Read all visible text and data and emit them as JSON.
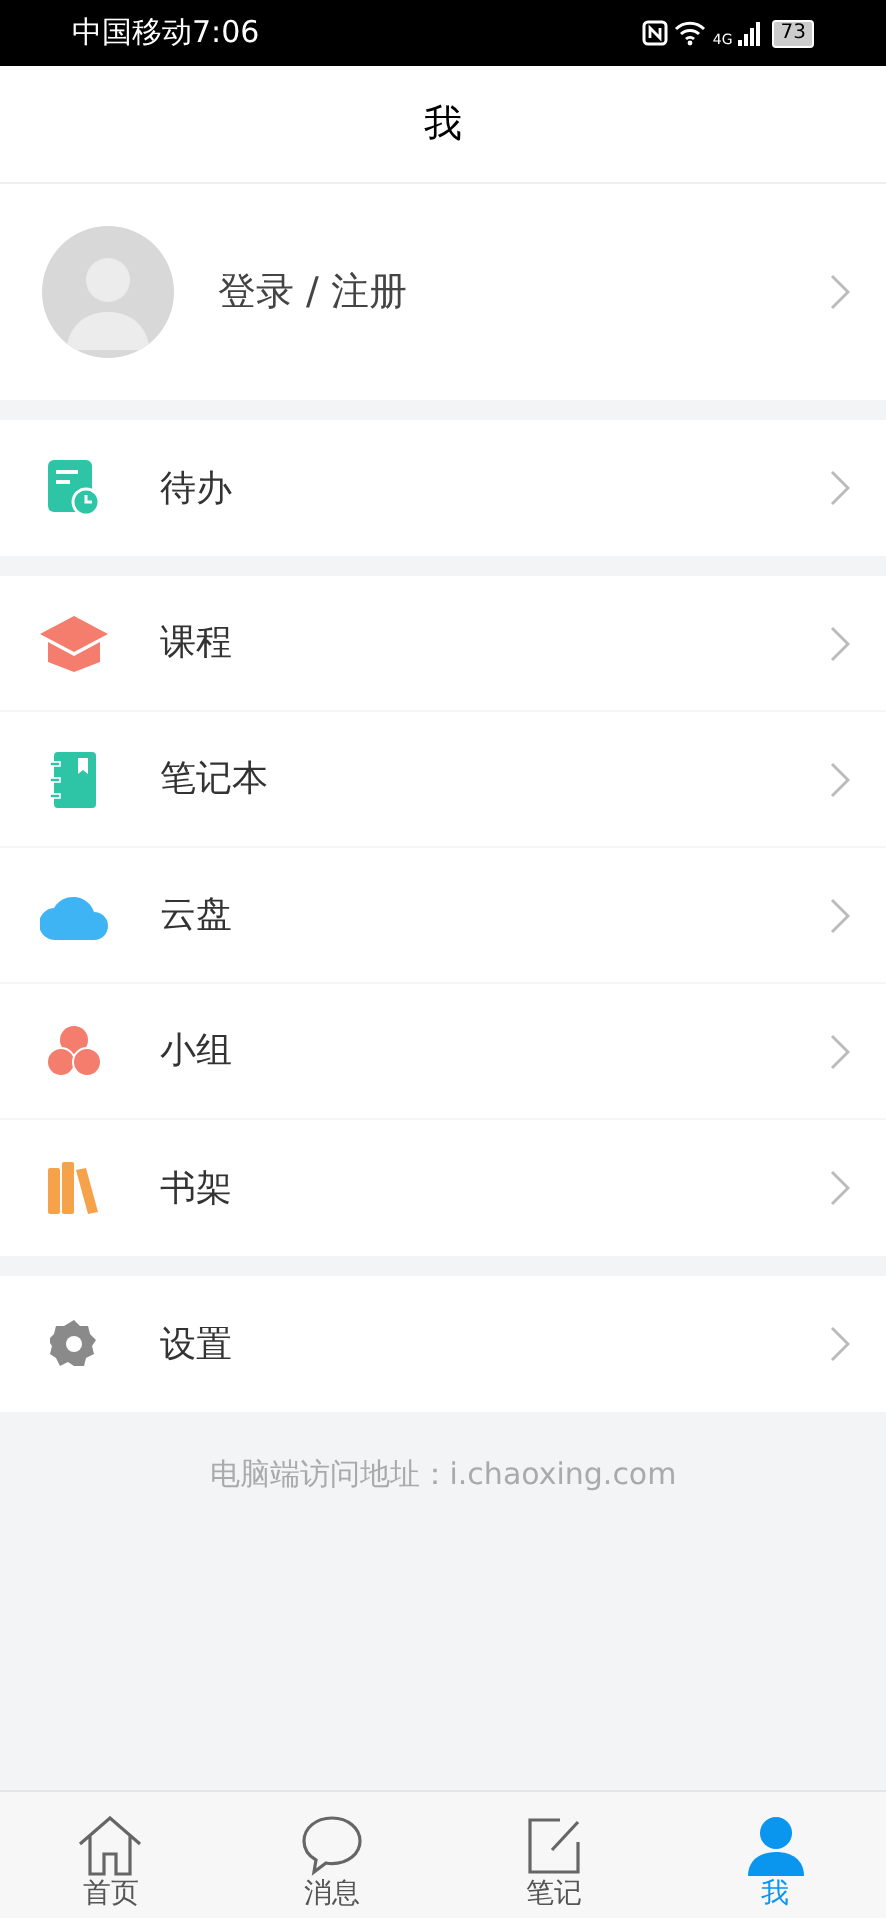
{
  "status_bar": {
    "carrier": "中国移动",
    "time": "7:06",
    "network": "4G",
    "battery": "73"
  },
  "header": {
    "title": "我"
  },
  "profile": {
    "label": "登录 / 注册"
  },
  "menu_groups": [
    [
      {
        "kind": "todo",
        "label": "待办"
      }
    ],
    [
      {
        "kind": "course",
        "label": "课程"
      },
      {
        "kind": "notebook",
        "label": "笔记本"
      },
      {
        "kind": "cloud",
        "label": "云盘"
      },
      {
        "kind": "group",
        "label": "小组"
      },
      {
        "kind": "bookshelf",
        "label": "书架"
      }
    ],
    [
      {
        "kind": "settings",
        "label": "设置"
      }
    ]
  ],
  "footer_note": "电脑端访问地址：i.chaoxing.com",
  "tabs": [
    {
      "kind": "home",
      "label": "首页",
      "selected": false
    },
    {
      "kind": "message",
      "label": "消息",
      "selected": false
    },
    {
      "kind": "note",
      "label": "笔记",
      "selected": false
    },
    {
      "kind": "me",
      "label": "我",
      "selected": true
    }
  ]
}
